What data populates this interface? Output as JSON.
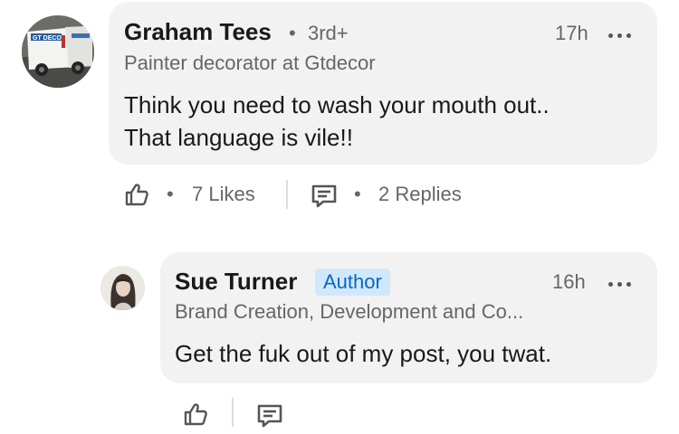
{
  "comment": {
    "author": "Graham Tees",
    "connection": "3rd+",
    "headline": "Painter decorator at Gtdecor",
    "time": "17h",
    "text_line1": "Think you need to wash your mouth out..",
    "text_line2": "That language is vile!!",
    "likes_label": "7 Likes",
    "replies_label": "2 Replies",
    "van_logo_text": "GT DECOR"
  },
  "reply": {
    "author": "Sue Turner",
    "badge": "Author",
    "headline": "Brand Creation, Development and Co...",
    "time": "16h",
    "text": "Get the fuk out of my post, you twat."
  },
  "separator": "•",
  "colors": {
    "bubble": "#f2f2f2",
    "name": "#191919",
    "secondary": "#666666",
    "badge_bg": "#d0e8fb",
    "badge_text": "#0a66c2"
  },
  "icons": {
    "like": "thumbs-up-icon",
    "reply": "comment-icon",
    "more": "ellipsis-icon"
  }
}
